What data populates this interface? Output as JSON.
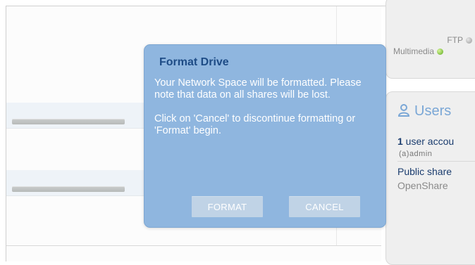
{
  "services": {
    "ftp_label": "FTP",
    "ftp_status_color": "#9a9a9a",
    "multimedia_label": "Multimedia",
    "multimedia_status_color": "#5caa1e"
  },
  "users_card": {
    "title": "Users",
    "account_count": "1",
    "account_text": " user accou",
    "account_name": "(a)admin",
    "public_share_label": "Public share",
    "public_share_value": "OpenShare"
  },
  "dialog": {
    "title": "Format Drive",
    "message_1": "Your Network Space will be formatted. Please note that data on all shares will be lost.",
    "message_2": "Click on 'Cancel' to discontinue formatting or 'Format' begin.",
    "format_button": "FORMAT",
    "cancel_button": "CANCEL"
  },
  "colors": {
    "dialog_bg": "#8fb6df",
    "dialog_title": "#1e4c86",
    "accent_text": "#1a3c6e",
    "button_bg": "#c0d3e6"
  }
}
